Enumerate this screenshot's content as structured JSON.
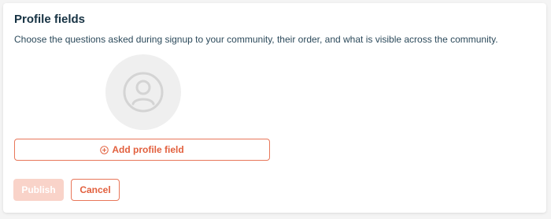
{
  "section": {
    "title": "Profile fields",
    "description": "Choose the questions asked during signup to your community, their order, and what is visible across the community."
  },
  "avatar": {
    "icon": "user-circle-icon"
  },
  "add_field": {
    "icon": "plus-circle-icon",
    "label": "Add profile field"
  },
  "actions": {
    "publish_label": "Publish",
    "publish_disabled": true,
    "cancel_label": "Cancel"
  },
  "colors": {
    "accent": "#e2603e",
    "accent_border": "#e8775a",
    "disabled_bg": "#f9d3c9",
    "heading": "#163243"
  }
}
